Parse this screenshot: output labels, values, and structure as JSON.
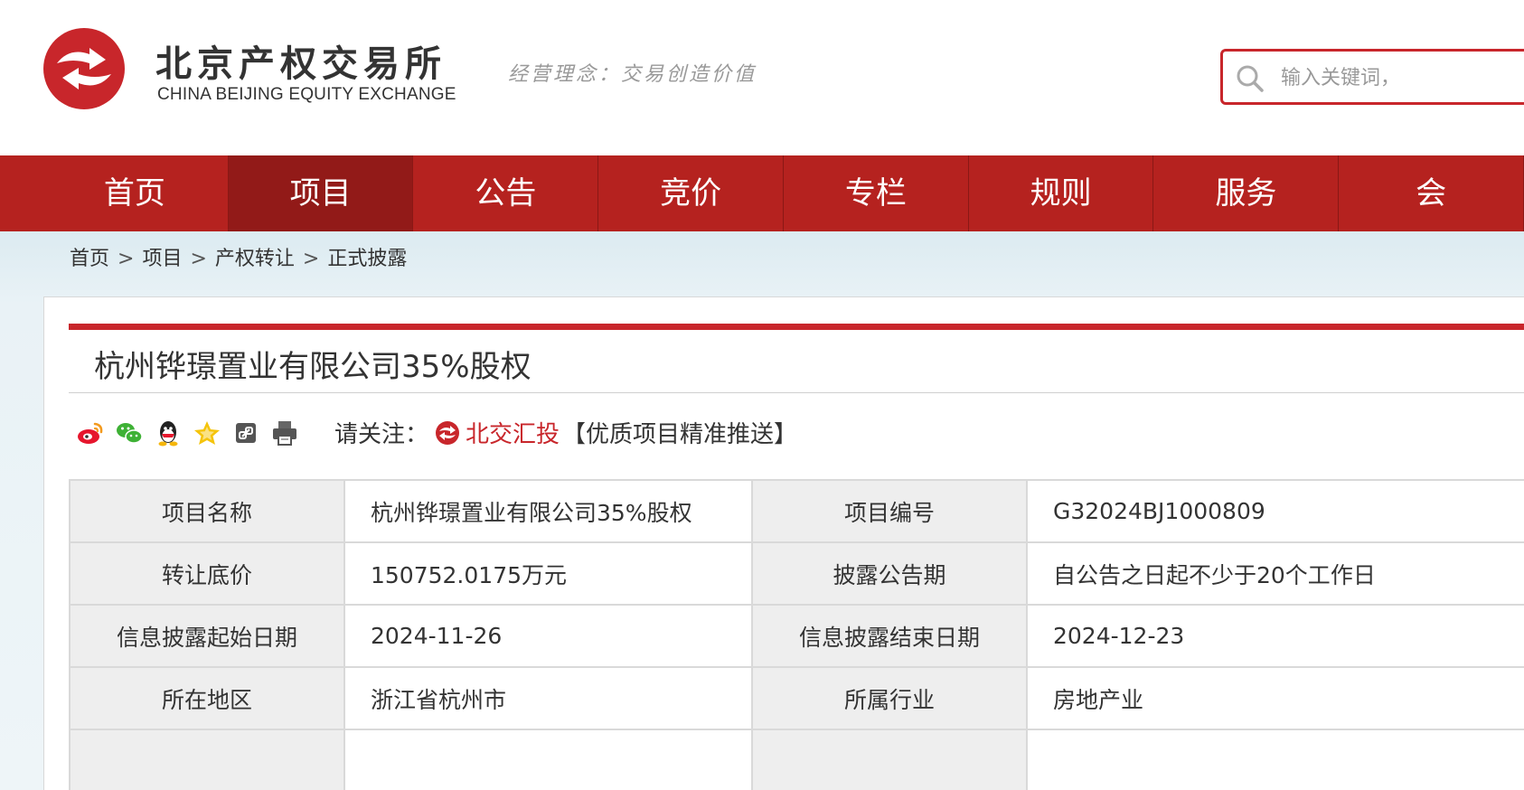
{
  "header": {
    "logo_cn": "北京产权交易所",
    "logo_en": "CHINA BEIJING EQUITY EXCHANGE",
    "slogan": "经营理念：交易创造价值",
    "search_placeholder": "输入关键词，",
    "brand_color": "#c8262b"
  },
  "nav": {
    "items": [
      {
        "label": "首页",
        "active": false
      },
      {
        "label": "项目",
        "active": true
      },
      {
        "label": "公告",
        "active": false
      },
      {
        "label": "竞价",
        "active": false
      },
      {
        "label": "专栏",
        "active": false
      },
      {
        "label": "规则",
        "active": false
      },
      {
        "label": "服务",
        "active": false
      },
      {
        "label": "会",
        "active": false
      }
    ],
    "bg_color": "#b5221f",
    "active_color": "#921a18"
  },
  "breadcrumb": [
    "首页",
    "项目",
    "产权转让",
    "正式披露"
  ],
  "breadcrumb_sep": ">",
  "project": {
    "title": "杭州铧璟置业有限公司35%股权"
  },
  "share": {
    "icons": [
      "weibo-icon",
      "wechat-icon",
      "qq-icon",
      "favorite-star-icon",
      "copy-link-icon",
      "print-icon"
    ],
    "follow_label": "请关注：",
    "follow_brand": "北交汇投",
    "follow_tag": "【优质项目精准推送】"
  },
  "info_table": {
    "rows": [
      {
        "k1": "项目名称",
        "v1": "杭州铧璟置业有限公司35%股权",
        "k2": "项目编号",
        "v2": "G32024BJ1000809"
      },
      {
        "k1": "转让底价",
        "v1": "150752.0175万元",
        "k2": "披露公告期",
        "v2": "自公告之日起不少于20个工作日"
      },
      {
        "k1": "信息披露起始日期",
        "v1": "2024-11-26",
        "k2": "信息披露结束日期",
        "v2": "2024-12-23"
      },
      {
        "k1": "所在地区",
        "v1": "浙江省杭州市",
        "k2": "所属行业",
        "v2": "房地产业"
      }
    ]
  }
}
